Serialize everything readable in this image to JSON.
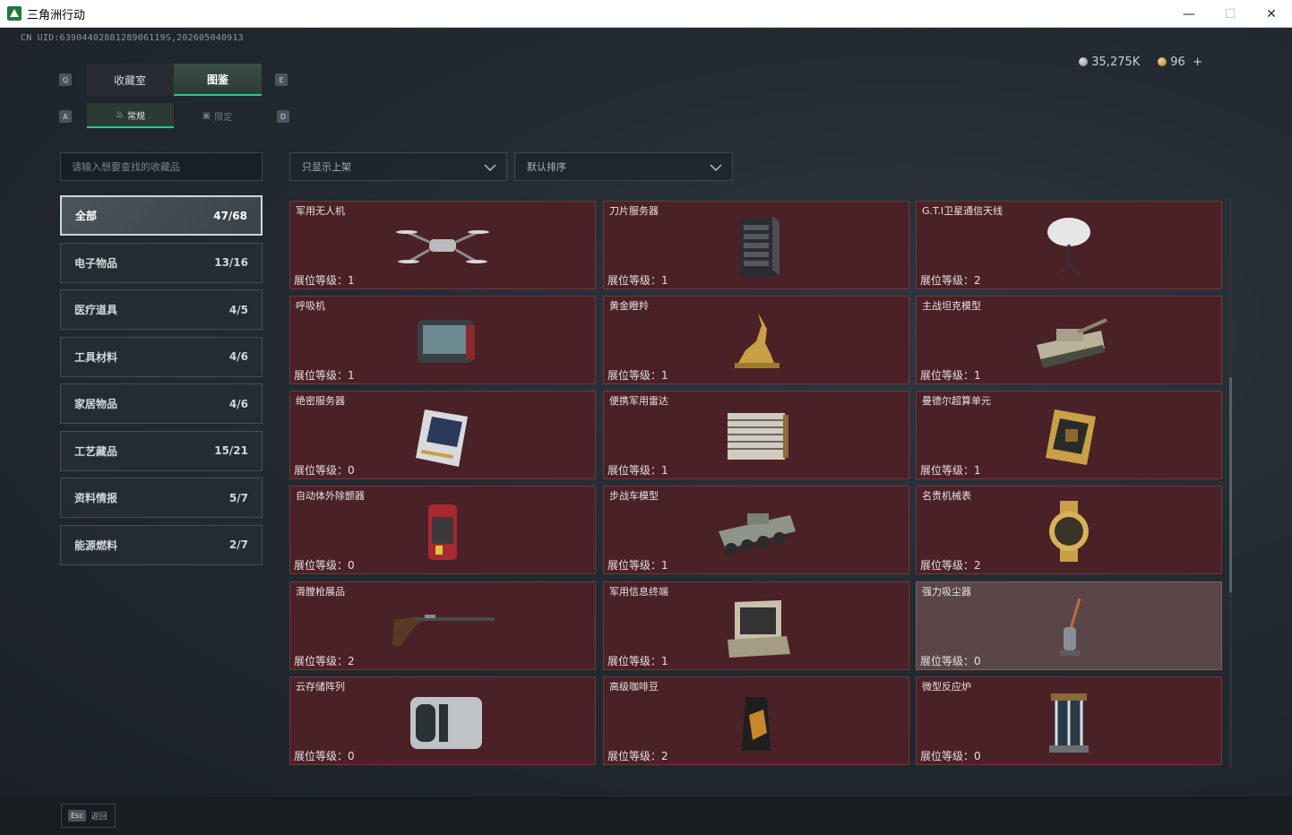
{
  "window": {
    "title": "三角洲行动",
    "controls": {
      "minimize": "—",
      "maximize": "☐",
      "close": "✕"
    }
  },
  "uid": "CN UID:6390440288128906119S,202605040913",
  "currency": {
    "coins": "35,275K",
    "tokens": "96",
    "add": "+"
  },
  "keys": {
    "left_tab": "Q",
    "right_tab": "E",
    "left_sub": "A",
    "right_sub": "D"
  },
  "main_tabs": [
    {
      "label": "收藏室",
      "active": false
    },
    {
      "label": "图鉴",
      "active": true
    }
  ],
  "sub_tabs": [
    {
      "label": "常规",
      "active": true
    },
    {
      "label": "限定",
      "active": false
    }
  ],
  "search": {
    "placeholder": "请输入想要查找的收藏品"
  },
  "filter": {
    "value": "只显示上架"
  },
  "sort": {
    "value": "默认排序"
  },
  "categories": [
    {
      "label": "全部",
      "count": "47/68",
      "active": true
    },
    {
      "label": "电子物品",
      "count": "13/16"
    },
    {
      "label": "医疗道具",
      "count": "4/5"
    },
    {
      "label": "工具材料",
      "count": "4/6"
    },
    {
      "label": "家居物品",
      "count": "4/6"
    },
    {
      "label": "工艺藏品",
      "count": "15/21"
    },
    {
      "label": "资料情报",
      "count": "5/7"
    },
    {
      "label": "能源燃料",
      "count": "2/7"
    }
  ],
  "items": [
    {
      "name": "军用无人机",
      "level": "展位等级：1",
      "icon": "drone-icon"
    },
    {
      "name": "刀片服务器",
      "level": "展位等级：1",
      "icon": "server-icon"
    },
    {
      "name": "G.T.I卫星通信天线",
      "level": "展位等级：2",
      "icon": "satellite-dish-icon"
    },
    {
      "name": "呼吸机",
      "level": "展位等级：1",
      "icon": "ventilator-icon"
    },
    {
      "name": "黄金瞪羚",
      "level": "展位等级：1",
      "icon": "gazelle-statue-icon"
    },
    {
      "name": "主战坦克模型",
      "level": "展位等级：1",
      "icon": "tank-model-icon"
    },
    {
      "name": "绝密服务器",
      "level": "展位等级：0",
      "icon": "secret-server-icon"
    },
    {
      "name": "便携军用雷达",
      "level": "展位等级：1",
      "icon": "radar-icon"
    },
    {
      "name": "曼德尔超算单元",
      "level": "展位等级：1",
      "icon": "compute-unit-icon"
    },
    {
      "name": "自动体外除颤器",
      "level": "展位等级：0",
      "icon": "defibrillator-icon"
    },
    {
      "name": "步战车模型",
      "level": "展位等级：1",
      "icon": "ifv-model-icon"
    },
    {
      "name": "名贵机械表",
      "level": "展位等级：2",
      "icon": "watch-icon"
    },
    {
      "name": "滑膛枪展品",
      "level": "展位等级：2",
      "icon": "musket-icon"
    },
    {
      "name": "军用信息终端",
      "level": "展位等级：1",
      "icon": "terminal-icon"
    },
    {
      "name": "强力吸尘器",
      "level": "展位等级：0",
      "icon": "vacuum-icon"
    },
    {
      "name": "云存储阵列",
      "level": "展位等级：0",
      "icon": "storage-array-icon"
    },
    {
      "name": "高级咖啡豆",
      "level": "展位等级：2",
      "icon": "coffee-bag-icon"
    },
    {
      "name": "微型反应炉",
      "level": "展位等级：0",
      "icon": "reactor-icon"
    }
  ],
  "footer": {
    "esc_key": "Esc",
    "esc_label": "返回"
  }
}
